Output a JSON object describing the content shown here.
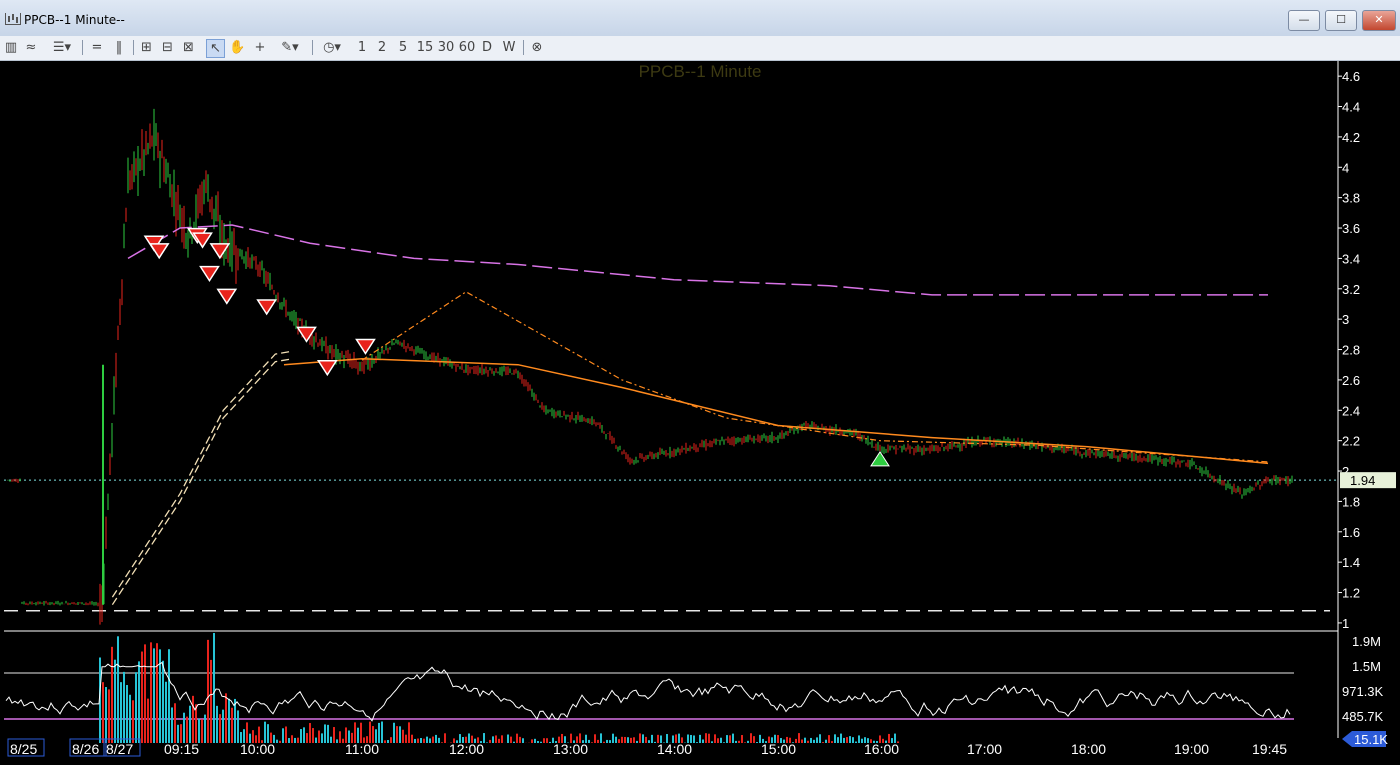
{
  "window": {
    "title": "PPCB--1 Minute--",
    "min_label": "—",
    "max_label": "☐",
    "close_label": "✕"
  },
  "toolbar": {
    "interval_buttons": [
      "1",
      "2",
      "5",
      "15",
      "30",
      "60",
      "D",
      "W"
    ]
  },
  "colors": {
    "background": "#000000",
    "up_bar": "#2ecc40",
    "down_bar": "#e8231c",
    "vwap_purple": "#d873e6",
    "ma_orange": "#ff8a1e",
    "ma_cream": "#f2dfb5",
    "price_line": "#7fe3e3",
    "axis_text": "#ffffff",
    "volume_up": "#27c4d6",
    "volume_down": "#e8231c",
    "oscillator": "#ffffff",
    "band_line": "#d873e6"
  },
  "chart_data": {
    "type": "candlestick",
    "title": "PPCB--1 Minute",
    "current_price_label": "1.94",
    "y_ticks": [
      "4.6",
      "4.4",
      "4.2",
      "4",
      "3.8",
      "3.6",
      "3.4",
      "3.2",
      "3",
      "2.8",
      "2.6",
      "2.4",
      "2.2",
      "2",
      "1.8",
      "1.6",
      "1.4",
      "1.2",
      "1"
    ],
    "y_tick_values": [
      4.6,
      4.4,
      4.2,
      4.0,
      3.8,
      3.6,
      3.4,
      3.2,
      3.0,
      2.8,
      2.6,
      2.4,
      2.2,
      2.0,
      1.8,
      1.6,
      1.4,
      1.2,
      1.0
    ],
    "ylim": [
      0.96,
      4.68
    ],
    "x_ticks": [
      "8/25",
      "8/26",
      "8/27",
      "09:15",
      "10:00",
      "11:00",
      "12:00",
      "13:00",
      "14:00",
      "15:00",
      "16:00",
      "17:00",
      "18:00",
      "19:00",
      "19:45"
    ],
    "price_path": [
      [
        "8/25",
        1.13
      ],
      [
        "8/26",
        1.13
      ],
      [
        "8/27 09:00",
        1.12
      ],
      [
        "8/27 09:02",
        2.3
      ],
      [
        "8/27 09:05",
        3.9
      ],
      [
        "8/27 09:10",
        4.2
      ],
      [
        "8/27 09:15",
        3.7
      ],
      [
        "8/27 09:20",
        3.55
      ],
      [
        "8/27 09:30",
        3.9
      ],
      [
        "8/27 09:40",
        3.5
      ],
      [
        "8/27 10:00",
        3.35
      ],
      [
        "8/27 10:20",
        3.0
      ],
      [
        "8/27 10:40",
        2.8
      ],
      [
        "8/27 11:00",
        2.68
      ],
      [
        "8/27 11:20",
        2.85
      ],
      [
        "8/27 11:40",
        2.75
      ],
      [
        "8/27 12:00",
        2.67
      ],
      [
        "8/27 12:30",
        2.65
      ],
      [
        "8/27 12:45",
        2.4
      ],
      [
        "8/27 13:15",
        2.32
      ],
      [
        "8/27 13:35",
        2.07
      ],
      [
        "8/27 14:00",
        2.13
      ],
      [
        "8/27 14:30",
        2.2
      ],
      [
        "8/27 15:00",
        2.22
      ],
      [
        "8/27 15:15",
        2.3
      ],
      [
        "8/27 15:45",
        2.25
      ],
      [
        "8/27 16:00",
        2.15
      ],
      [
        "8/27 16:30",
        2.14
      ],
      [
        "8/27 17:00",
        2.2
      ],
      [
        "8/27 17:30",
        2.17
      ],
      [
        "8/27 18:00",
        2.12
      ],
      [
        "8/27 18:30",
        2.09
      ],
      [
        "8/27 19:00",
        2.05
      ],
      [
        "8/27 19:30",
        1.85
      ],
      [
        "8/27 19:45",
        1.94
      ]
    ],
    "vwap_line": [
      [
        "8/27 09:05",
        3.4
      ],
      [
        "8/27 09:15",
        3.6
      ],
      [
        "8/27 09:45",
        3.62
      ],
      [
        "8/27 10:30",
        3.5
      ],
      [
        "8/27 11:30",
        3.4
      ],
      [
        "8/27 12:30",
        3.36
      ],
      [
        "8/27 14:00",
        3.26
      ],
      [
        "8/27 15:30",
        3.22
      ],
      [
        "8/27 16:30",
        3.16
      ],
      [
        "8/27 18:00",
        3.16
      ],
      [
        "8/27 19:45",
        3.16
      ]
    ],
    "ma_orange_line": [
      [
        "8/27 10:15",
        2.7
      ],
      [
        "8/27 11:00",
        2.74
      ],
      [
        "8/27 12:30",
        2.7
      ],
      [
        "8/27 13:30",
        2.55
      ],
      [
        "8/27 15:00",
        2.3
      ],
      [
        "8/27 16:30",
        2.22
      ],
      [
        "8/27 18:00",
        2.16
      ],
      [
        "8/27 19:45",
        2.05
      ]
    ],
    "ma_orange_dashed": [
      [
        "8/27 11:00",
        2.73
      ],
      [
        "8/27 12:00",
        3.18
      ],
      [
        "8/27 13:30",
        2.6
      ],
      [
        "8/27 14:30",
        2.35
      ],
      [
        "8/27 16:00",
        2.2
      ],
      [
        "8/27 17:30",
        2.17
      ],
      [
        "8/27 19:45",
        2.06
      ]
    ],
    "ma_cream_dashed": [
      [
        "8/27 09:02",
        1.12
      ],
      [
        "8/27 09:15",
        1.8
      ],
      [
        "8/27 09:40",
        2.35
      ],
      [
        "8/27 10:10",
        2.72
      ],
      [
        "8/27 10:20",
        2.74
      ]
    ],
    "reference_line": 1.08,
    "sell_signals": [
      [
        "8/27 09:10",
        3.5
      ],
      [
        "8/27 09:11",
        3.45
      ],
      [
        "8/27 09:25",
        3.55
      ],
      [
        "8/27 09:28",
        3.52
      ],
      [
        "8/27 09:32",
        3.3
      ],
      [
        "8/27 09:38",
        3.45
      ],
      [
        "8/27 09:42",
        3.15
      ],
      [
        "8/27 10:05",
        3.08
      ],
      [
        "8/27 10:28",
        2.9
      ],
      [
        "8/27 10:40",
        2.68
      ],
      [
        "8/27 11:02",
        2.82
      ]
    ],
    "buy_signals": [
      [
        "8/27 16:00",
        2.08
      ]
    ],
    "volume_axis": {
      "ticks": [
        "1.9M",
        "1.5M",
        "971.3K",
        "485.7K"
      ],
      "current_label": "15.1K"
    }
  }
}
